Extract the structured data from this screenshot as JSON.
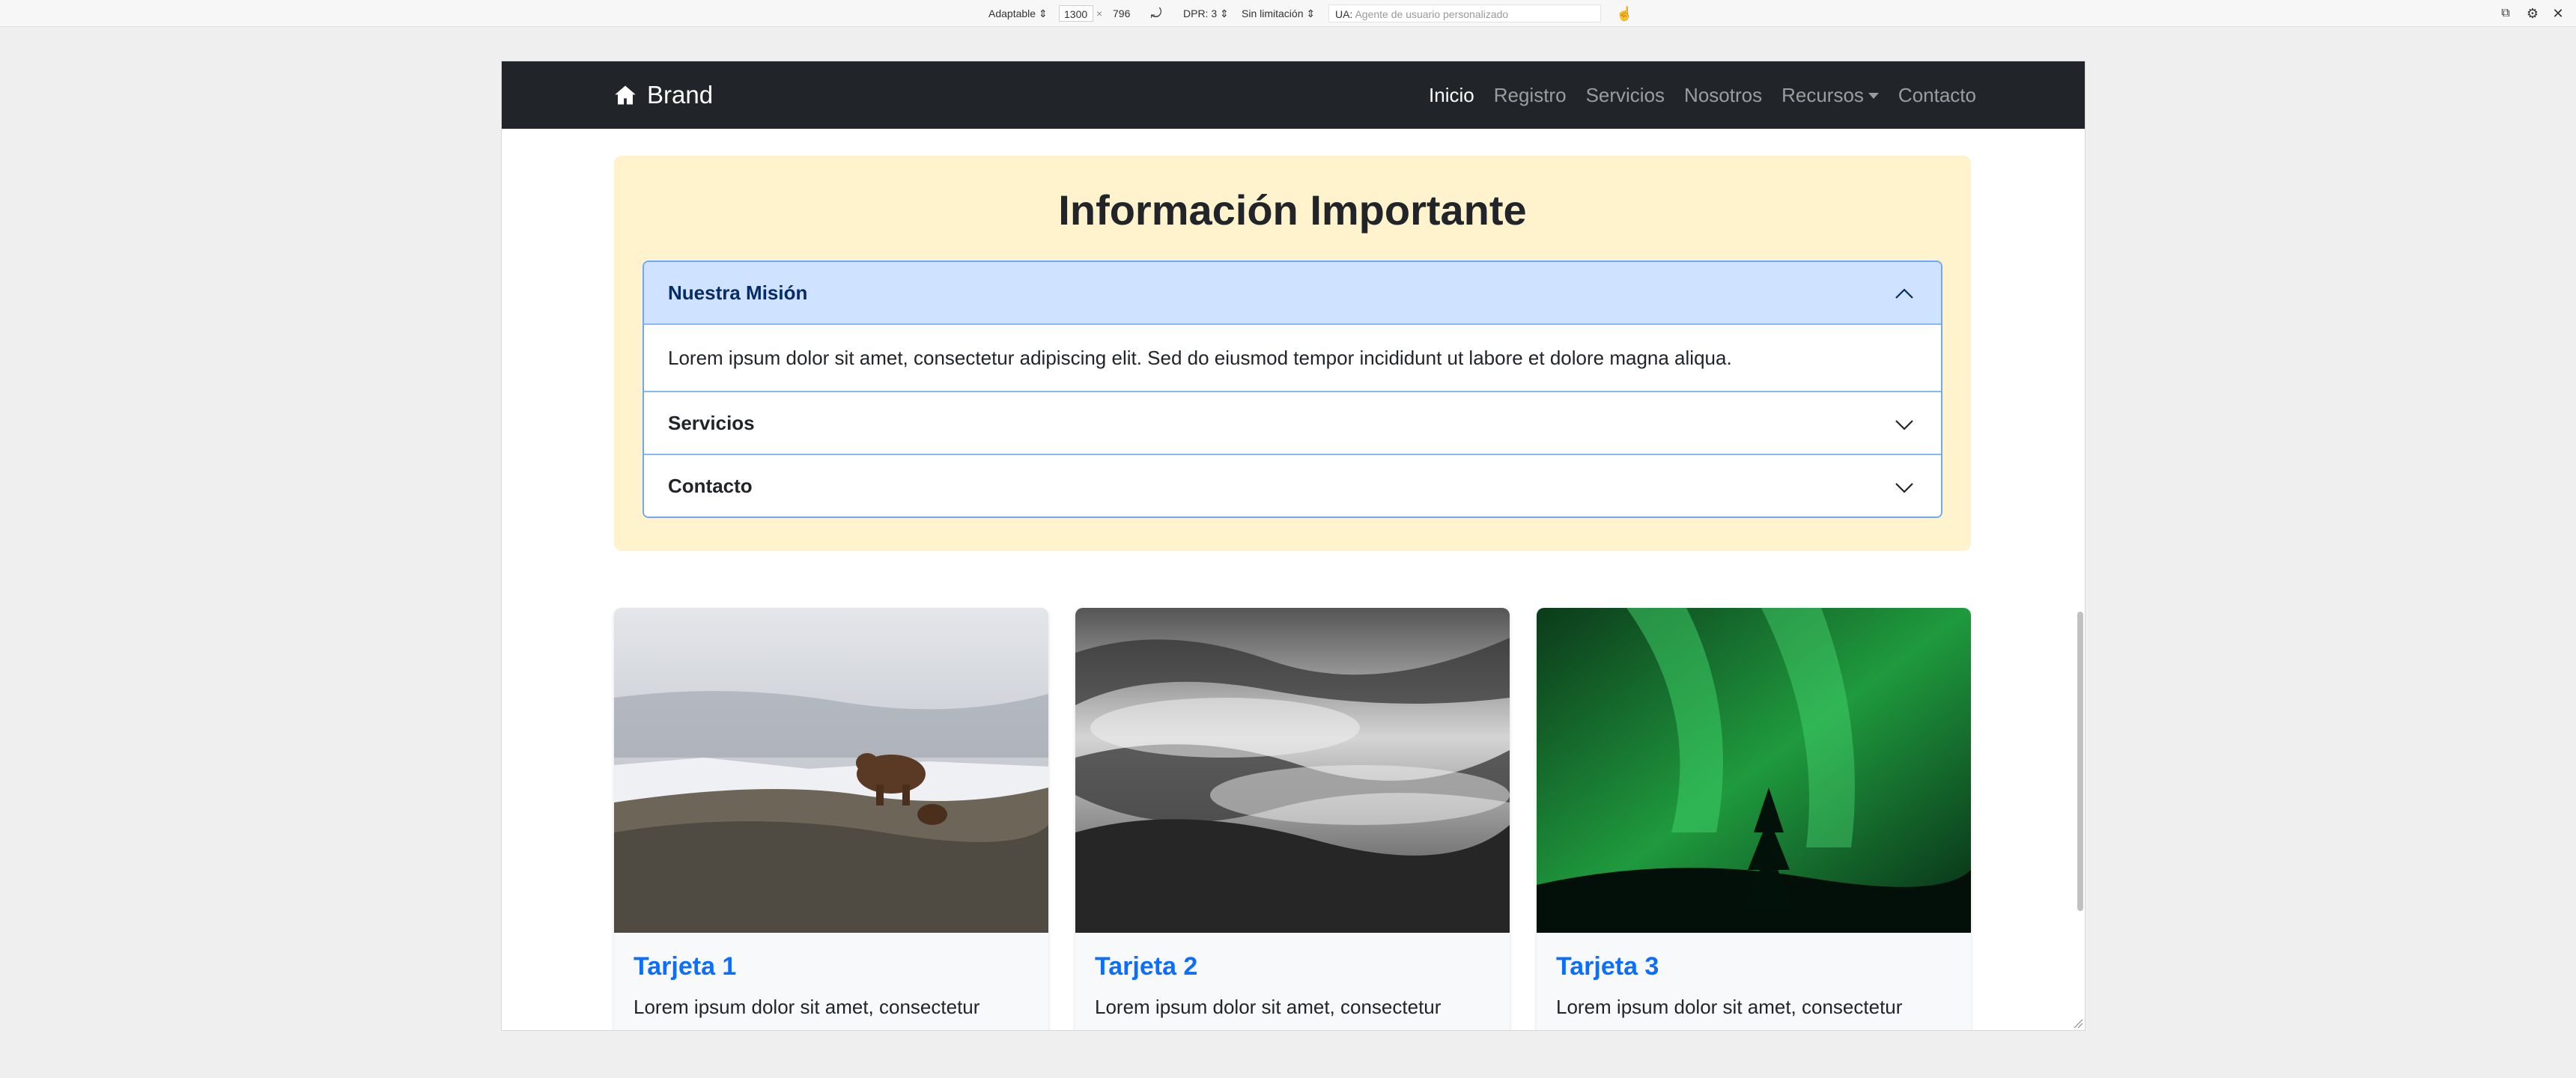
{
  "toolbar": {
    "device": "Adaptable",
    "width": "1300",
    "times": "×",
    "height": "796",
    "dpr": "DPR: 3",
    "throttling": "Sin limitación",
    "ua_label": "UA:",
    "ua_placeholder": "Agente de usuario personalizado"
  },
  "navbar": {
    "brand": "Brand",
    "links": [
      "Inicio",
      "Registro",
      "Servicios",
      "Nosotros",
      "Recursos",
      "Contacto"
    ]
  },
  "info": {
    "title": "Información Importante",
    "items": [
      {
        "title": "Nuestra Misión",
        "body": "Lorem ipsum dolor sit amet, consectetur adipiscing elit. Sed do eiusmod tempor incididunt ut labore et dolore magna aliqua."
      },
      {
        "title": "Servicios"
      },
      {
        "title": "Contacto"
      }
    ]
  },
  "cards": [
    {
      "title": "Tarjeta 1",
      "text": "Lorem ipsum dolor sit amet, consectetur"
    },
    {
      "title": "Tarjeta 2",
      "text": "Lorem ipsum dolor sit amet, consectetur"
    },
    {
      "title": "Tarjeta 3",
      "text": "Lorem ipsum dolor sit amet, consectetur"
    }
  ],
  "colors": {
    "navbar_bg": "#212529",
    "info_bg": "#fff3cd",
    "accordion_active_bg": "#cfe2ff",
    "card_title": "#0d6efd"
  }
}
